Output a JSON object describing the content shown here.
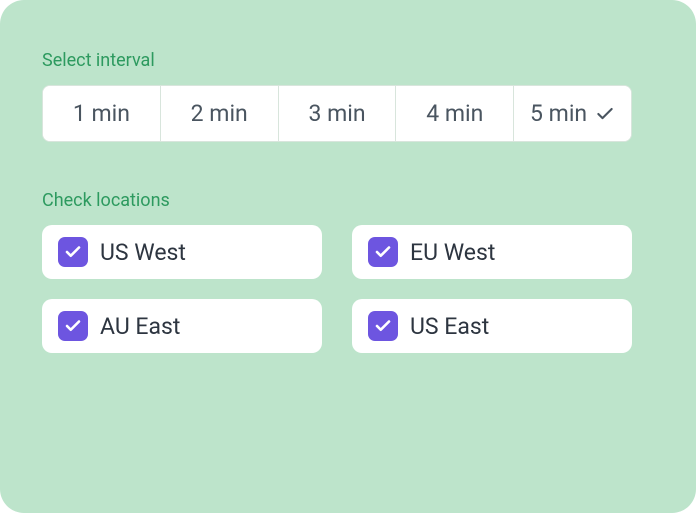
{
  "interval": {
    "label": "Select interval",
    "options": [
      {
        "label": "1 min",
        "selected": false
      },
      {
        "label": "2 min",
        "selected": false
      },
      {
        "label": "3 min",
        "selected": false
      },
      {
        "label": "4 min",
        "selected": false
      },
      {
        "label": "5 min",
        "selected": true
      }
    ]
  },
  "locations": {
    "label": "Check locations",
    "items": [
      {
        "label": "US West",
        "checked": true
      },
      {
        "label": "EU West",
        "checked": true
      },
      {
        "label": "AU East",
        "checked": true
      },
      {
        "label": "US East",
        "checked": true
      }
    ]
  },
  "colors": {
    "panel_bg": "#bde4cb",
    "accent_green": "#2d9a5f",
    "checkbox": "#6d55e0"
  }
}
